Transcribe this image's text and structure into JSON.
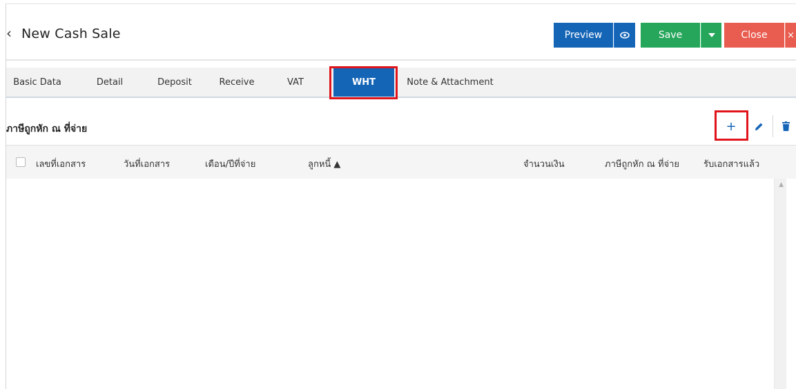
{
  "header": {
    "back_icon": "‹",
    "title": "New Cash Sale",
    "buttons": {
      "preview": "Preview",
      "save": "Save",
      "close": "Close"
    }
  },
  "tabs": [
    {
      "label": "Basic Data",
      "active": false
    },
    {
      "label": "Detail",
      "active": false
    },
    {
      "label": "Deposit",
      "active": false
    },
    {
      "label": "Receive",
      "active": false
    },
    {
      "label": "VAT",
      "active": false
    },
    {
      "label": "WHT",
      "active": true
    },
    {
      "label": "Note & Attachment",
      "active": false
    }
  ],
  "section": {
    "title": "ภาษีถูกหัก ณ ที่จ่าย"
  },
  "table": {
    "columns": [
      "เลขที่เอกสาร",
      "วันที่เอกสาร",
      "เดือน/ปีที่จ่าย",
      "ลูกหนี้ ▲",
      "จำนวนเงิน",
      "ภาษีถูกหัก ณ ที่จ่าย",
      "รับเอกสารแล้ว"
    ],
    "rows": []
  },
  "colors": {
    "primary": "#1565b7",
    "success": "#26a65b",
    "danger": "#e95c50",
    "highlight": "#e0141b"
  }
}
